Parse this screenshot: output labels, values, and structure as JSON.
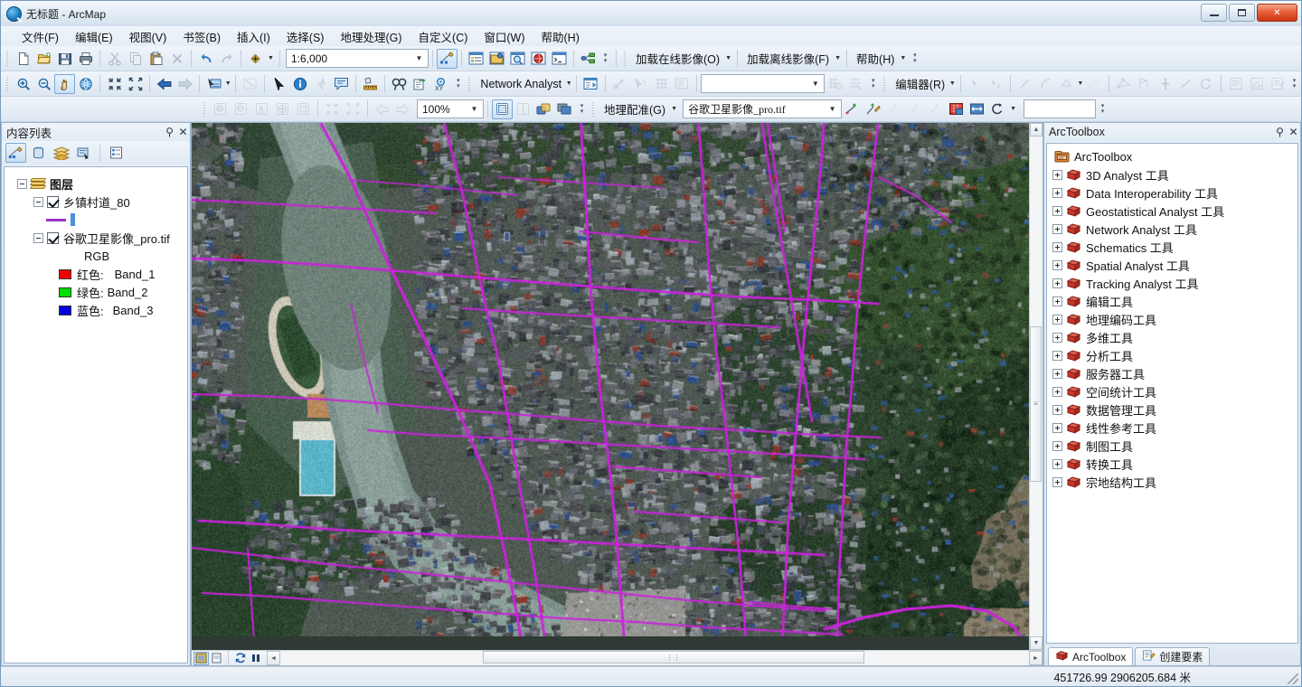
{
  "window": {
    "title": "无标题 - ArcMap",
    "app_icon": "arcmap-globe-icon",
    "minimize_label": "最小化",
    "maximize_label": "最大化",
    "close_label": "✕"
  },
  "menubar": {
    "items": [
      {
        "label": "文件(F)",
        "name": "menu-file"
      },
      {
        "label": "编辑(E)",
        "name": "menu-edit"
      },
      {
        "label": "视图(V)",
        "name": "menu-view"
      },
      {
        "label": "书签(B)",
        "name": "menu-bookmarks"
      },
      {
        "label": "插入(I)",
        "name": "menu-insert"
      },
      {
        "label": "选择(S)",
        "name": "menu-selection"
      },
      {
        "label": "地理处理(G)",
        "name": "menu-geoprocessing"
      },
      {
        "label": "自定义(C)",
        "name": "menu-customize"
      },
      {
        "label": "窗口(W)",
        "name": "menu-window"
      },
      {
        "label": "帮助(H)",
        "name": "menu-help"
      }
    ]
  },
  "toolbars": {
    "standard": {
      "scale_value": "1:6,000",
      "buttons": [
        "new-document-icon",
        "open-document-icon",
        "save-icon",
        "print-icon",
        "cut-icon",
        "copy-icon",
        "paste-icon",
        "delete-icon",
        "undo-icon",
        "redo-icon",
        "add-data-icon"
      ],
      "editor_toggle": "editor-toolbar-icon",
      "extra_buttons": [
        "table-of-contents-icon",
        "catalog-window-icon",
        "search-window-icon",
        "arcglobe-icon",
        "python-window-icon",
        "model-builder-icon"
      ]
    },
    "online_image": {
      "load_online_label": "加载在线影像(O)",
      "load_offline_label": "加载离线影像(F)",
      "help_label": "帮助(H)"
    },
    "tools": {
      "buttons": [
        "zoom-in-icon",
        "zoom-out-icon",
        "pan-icon",
        "full-extent-icon",
        "fixed-zoom-in-icon",
        "fixed-zoom-out-icon",
        "go-back-extent-icon",
        "go-forward-extent-icon",
        "select-features-icon",
        "clear-selection-icon",
        "select-elements-icon",
        "identify-icon",
        "hyperlink-icon",
        "html-popup-icon",
        "measure-icon",
        "find-icon",
        "find-route-icon",
        "go-to-xy-icon"
      ]
    },
    "network_analyst": {
      "label": "Network Analyst",
      "window_icon": "network-analyst-window-icon",
      "buttons": [
        "create-network-location-icon",
        "select-network-location-icon",
        "build-network-icon",
        "directions-window-icon"
      ],
      "combo_value": ""
    },
    "editor": {
      "label": "编辑器(R)",
      "buttons": [
        "edit-tool-icon",
        "edit-annotation-icon",
        "straight-segment-icon",
        "endpoint-arc-icon",
        "construction-tool-icon",
        "trace-icon",
        "edit-vertices-icon",
        "reshape-feature-icon",
        "split-icon",
        "rotate-icon",
        "attributes-icon",
        "sketch-properties-icon",
        "create-features-icon"
      ]
    },
    "georef": {
      "zoom_value": "100%",
      "label": "地理配准(G)",
      "layer_value": "谷歌卫星影像_pro.tif",
      "textbox_value": "",
      "left_buttons": [
        "zoom-in-icon",
        "zoom-out-icon",
        "pan-icon",
        "full-extent-icon",
        "image-display-icon",
        "rotate-left-icon",
        "rotate-right-icon",
        "shift-left-icon",
        "shift-right-icon"
      ],
      "right_buttons": [
        "flicker-icon",
        "swipe-icon",
        "transparency-icon",
        "effects-icon"
      ],
      "georef_buttons": [
        "add-control-points-icon",
        "auto-register-icon",
        "view-link-table-icon",
        "update-georeferencing-icon",
        "rectify-icon",
        "rotate-icon"
      ]
    }
  },
  "toc": {
    "title": "内容列表",
    "pin_icon": "pin-icon",
    "close_icon": "close-icon",
    "tool_buttons": [
      "list-by-drawing-order-icon",
      "list-by-source-icon",
      "list-by-visibility-icon",
      "list-by-selection-icon",
      "options-icon"
    ],
    "root_label": "图层",
    "layers": [
      {
        "name": "乡镇村道_80",
        "checked": true,
        "type": "vector",
        "symbol_line_color": "#9b30c8"
      },
      {
        "name": "谷歌卫星影像_pro.tif",
        "checked": true,
        "type": "raster",
        "renderer": "RGB",
        "bands": [
          {
            "label": "红色:",
            "band": "Band_1",
            "color": "#ee0000"
          },
          {
            "label": "绿色:",
            "band": "Band_2",
            "color": "#00dd00"
          },
          {
            "label": "蓝色:",
            "band": "Band_3",
            "color": "#0000dd"
          }
        ]
      }
    ]
  },
  "arctoolbox": {
    "title": "ArcToolbox",
    "pin_icon": "pin-icon",
    "close_icon": "close-icon",
    "root_label": "ArcToolbox",
    "items": [
      "3D Analyst 工具",
      "Data Interoperability 工具",
      "Geostatistical Analyst 工具",
      "Network Analyst 工具",
      "Schematics 工具",
      "Spatial Analyst 工具",
      "Tracking Analyst 工具",
      "编辑工具",
      "地理编码工具",
      "多维工具",
      "分析工具",
      "服务器工具",
      "空间统计工具",
      "数据管理工具",
      "线性参考工具",
      "制图工具",
      "转换工具",
      "宗地结构工具"
    ],
    "tabs": [
      {
        "label": "ArcToolbox",
        "icon": "toolbox-icon",
        "selected": true
      },
      {
        "label": "创建要素",
        "icon": "create-features-icon",
        "selected": false
      }
    ]
  },
  "map": {
    "bottom_buttons": [
      "data-view-icon",
      "layout-view-icon",
      "refresh-icon",
      "pause-drawing-icon"
    ],
    "scrollbar_h": "horizontal-scrollbar",
    "scrollbar_v": "vertical-scrollbar",
    "road_color": "#cc22dd",
    "water_color": "#6f8a82"
  },
  "statusbar": {
    "coordinates": "451726.99  2906205.684 米"
  }
}
